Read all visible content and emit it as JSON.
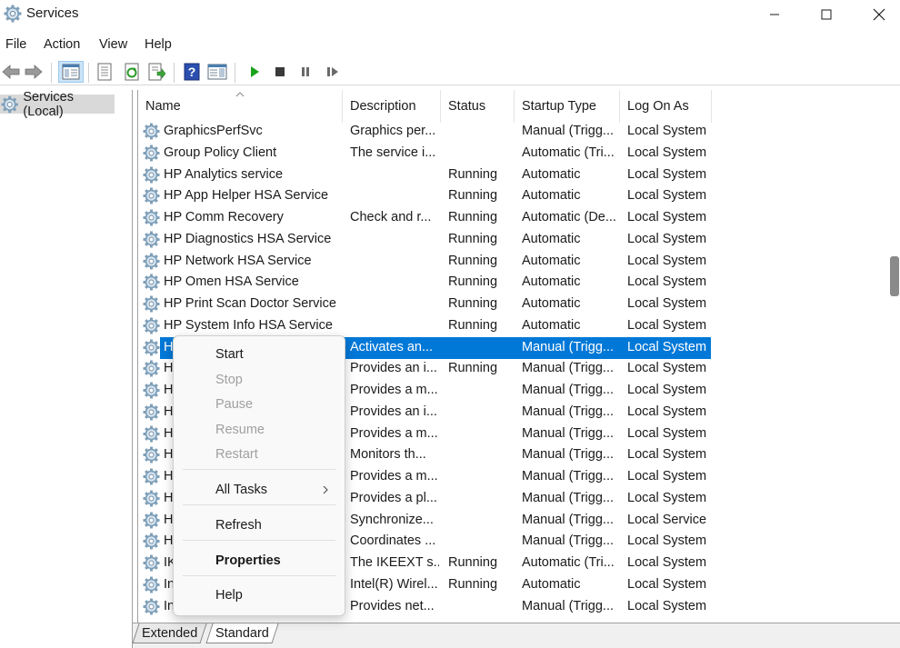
{
  "window": {
    "title": "Services",
    "icon": "services-gear-icon",
    "controls": [
      "minimize-icon",
      "maximize-icon",
      "close-icon"
    ]
  },
  "menu": [
    "File",
    "Action",
    "View",
    "Help"
  ],
  "toolbar": {
    "buttons": [
      "back-arrow-icon",
      "forward-arrow-icon",
      "show-hide-console-tree-icon",
      "properties-icon",
      "refresh-icon",
      "export-list-icon",
      "help-icon",
      "show-hide-action-pane-icon",
      "start-service-icon",
      "stop-service-icon",
      "pause-service-icon",
      "resume-service-icon"
    ]
  },
  "tree": {
    "label": "Services (Local)"
  },
  "columns": {
    "name": "Name",
    "description": "Description",
    "status": "Status",
    "startup": "Startup Type",
    "logon": "Log On As"
  },
  "rows": [
    {
      "name": "GraphicsPerfSvc",
      "description": "Graphics per...",
      "status": "",
      "startup": "Manual (Trigg...",
      "logon": "Local System"
    },
    {
      "name": "Group Policy Client",
      "description": "The service i...",
      "status": "",
      "startup": "Automatic (Tri...",
      "logon": "Local System"
    },
    {
      "name": "HP Analytics service",
      "description": "",
      "status": "Running",
      "startup": "Automatic",
      "logon": "Local System"
    },
    {
      "name": "HP App Helper HSA Service",
      "description": "",
      "status": "Running",
      "startup": "Automatic",
      "logon": "Local System"
    },
    {
      "name": "HP Comm Recovery",
      "description": "Check and r...",
      "status": "Running",
      "startup": "Automatic (De...",
      "logon": "Local System"
    },
    {
      "name": "HP Diagnostics HSA Service",
      "description": "",
      "status": "Running",
      "startup": "Automatic",
      "logon": "Local System"
    },
    {
      "name": "HP Network HSA Service",
      "description": "",
      "status": "Running",
      "startup": "Automatic",
      "logon": "Local System"
    },
    {
      "name": "HP Omen HSA Service",
      "description": "",
      "status": "Running",
      "startup": "Automatic",
      "logon": "Local System"
    },
    {
      "name": "HP Print Scan Doctor Service",
      "description": "",
      "status": "Running",
      "startup": "Automatic",
      "logon": "Local System"
    },
    {
      "name": "HP System Info HSA Service",
      "description": "",
      "status": "Running",
      "startup": "Automatic",
      "logon": "Local System"
    },
    {
      "name": "H",
      "description": "Activates an...",
      "status": "",
      "startup": "Manual (Trigg...",
      "logon": "Local System",
      "selected": true
    },
    {
      "name": "H",
      "description": "Provides an i...",
      "status": "Running",
      "startup": "Manual (Trigg...",
      "logon": "Local System"
    },
    {
      "name": "H",
      "description": "Provides a m...",
      "status": "",
      "startup": "Manual (Trigg...",
      "logon": "Local System"
    },
    {
      "name": "H",
      "description": "Provides an i...",
      "status": "",
      "startup": "Manual (Trigg...",
      "logon": "Local System"
    },
    {
      "name": "H",
      "description": "Provides a m...",
      "status": "",
      "startup": "Manual (Trigg...",
      "logon": "Local System"
    },
    {
      "name": "H",
      "description": "Monitors th...",
      "status": "",
      "startup": "Manual (Trigg...",
      "logon": "Local System"
    },
    {
      "name": "H",
      "description": "Provides a m...",
      "status": "",
      "startup": "Manual (Trigg...",
      "logon": "Local System"
    },
    {
      "name": "H",
      "description": "Provides a pl...",
      "status": "",
      "startup": "Manual (Trigg...",
      "logon": "Local System"
    },
    {
      "name": "H",
      "description": "Synchronize...",
      "status": "",
      "startup": "Manual (Trigg...",
      "logon": "Local Service"
    },
    {
      "name": "H",
      "description": "Coordinates ...",
      "status": "",
      "startup": "Manual (Trigg...",
      "logon": "Local System"
    },
    {
      "name": "IK",
      "description": "The IKEEXT s...",
      "status": "Running",
      "startup": "Automatic (Tri...",
      "logon": "Local System"
    },
    {
      "name": "In",
      "description": "Intel(R) Wirel...",
      "status": "Running",
      "startup": "Automatic",
      "logon": "Local System"
    },
    {
      "name": "Internet Connection Sharing...",
      "description": "Provides net...",
      "status": "",
      "startup": "Manual (Trigg...",
      "logon": "Local System"
    }
  ],
  "context_menu": {
    "start": "Start",
    "stop": "Stop",
    "pause": "Pause",
    "resume": "Resume",
    "restart": "Restart",
    "all_tasks": "All Tasks",
    "refresh": "Refresh",
    "properties": "Properties",
    "help": "Help"
  },
  "tabs": {
    "extended": "Extended",
    "standard": "Standard"
  },
  "colors": {
    "selection": "#0078d7",
    "tree_selection": "#d9d9d9",
    "play_green": "#1aa31a"
  }
}
